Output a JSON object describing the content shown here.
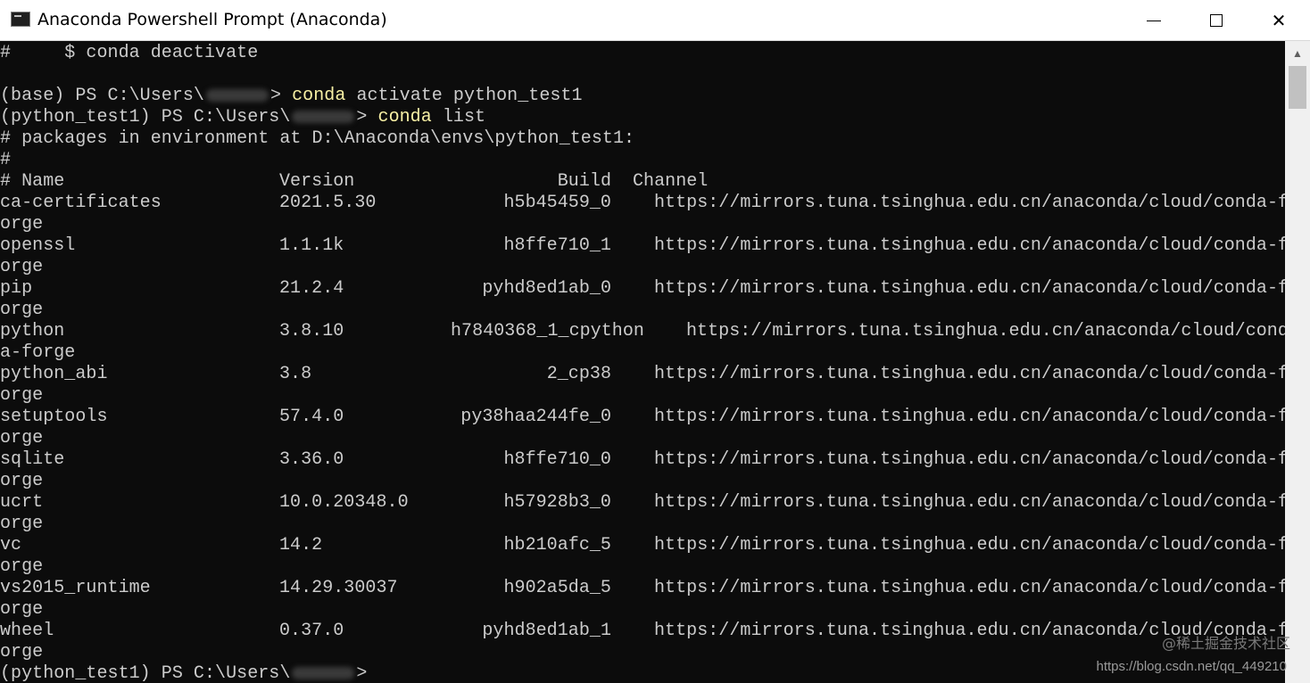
{
  "window": {
    "title": "Anaconda Powershell Prompt (Anaconda)",
    "controls": {
      "minimize": "—",
      "maximize": "☐",
      "close": "✕"
    }
  },
  "console": {
    "line_deactivate": "#     $ conda deactivate",
    "prompt_base": "(base) PS C:\\Users\\",
    "prompt_env": "(python_test1) PS C:\\Users\\",
    "prompt_end": ">",
    "cmd_activate_1": "conda",
    "cmd_activate_2": " activate python_test1",
    "cmd_list_1": "conda",
    "cmd_list_2": " list",
    "env_header": "# packages in environment at D:\\Anaconda\\envs\\python_test1:",
    "hash_line": "#",
    "columns": {
      "name": "# Name",
      "version": "Version",
      "build": "Build",
      "channel": "Channel"
    },
    "packages": [
      {
        "name": "ca-certificates",
        "version": "2021.5.30",
        "build": "h5b45459_0",
        "channel": "https://mirrors.tuna.tsinghua.edu.cn/anaconda/cloud/conda-f",
        "wrap": "orge"
      },
      {
        "name": "openssl",
        "version": "1.1.1k",
        "build": "h8ffe710_1",
        "channel": "https://mirrors.tuna.tsinghua.edu.cn/anaconda/cloud/conda-f",
        "wrap": "orge"
      },
      {
        "name": "pip",
        "version": "21.2.4",
        "build": "pyhd8ed1ab_0",
        "channel": "https://mirrors.tuna.tsinghua.edu.cn/anaconda/cloud/conda-f",
        "wrap": "orge"
      },
      {
        "name": "python",
        "version": "3.8.10",
        "build": "h7840368_1_cpython",
        "channel": "https://mirrors.tuna.tsinghua.edu.cn/anaconda/cloud/cond",
        "wrap": "a-forge"
      },
      {
        "name": "python_abi",
        "version": "3.8",
        "build": "2_cp38",
        "channel": "https://mirrors.tuna.tsinghua.edu.cn/anaconda/cloud/conda-f",
        "wrap": "orge"
      },
      {
        "name": "setuptools",
        "version": "57.4.0",
        "build": "py38haa244fe_0",
        "channel": "https://mirrors.tuna.tsinghua.edu.cn/anaconda/cloud/conda-f",
        "wrap": "orge"
      },
      {
        "name": "sqlite",
        "version": "3.36.0",
        "build": "h8ffe710_0",
        "channel": "https://mirrors.tuna.tsinghua.edu.cn/anaconda/cloud/conda-f",
        "wrap": "orge"
      },
      {
        "name": "ucrt",
        "version": "10.0.20348.0",
        "build": "h57928b3_0",
        "channel": "https://mirrors.tuna.tsinghua.edu.cn/anaconda/cloud/conda-f",
        "wrap": "orge"
      },
      {
        "name": "vc",
        "version": "14.2",
        "build": "hb210afc_5",
        "channel": "https://mirrors.tuna.tsinghua.edu.cn/anaconda/cloud/conda-f",
        "wrap": "orge"
      },
      {
        "name": "vs2015_runtime",
        "version": "14.29.30037",
        "build": "h902a5da_5",
        "channel": "https://mirrors.tuna.tsinghua.edu.cn/anaconda/cloud/conda-f",
        "wrap": "orge"
      },
      {
        "name": "wheel",
        "version": "0.37.0",
        "build": "pyhd8ed1ab_1",
        "channel": "https://mirrors.tuna.tsinghua.edu.cn/anaconda/cloud/conda-f",
        "wrap": "orge"
      }
    ]
  },
  "watermark": {
    "brand": "@稀土掘金技术社区",
    "url": "https://blog.csdn.net/qq_449210"
  },
  "colors": {
    "background": "#0c0c0c",
    "text": "#cccccc",
    "command": "#f9f1a5"
  },
  "icons": {
    "app": "terminal-icon",
    "scroll_up": "chevron-up-icon"
  }
}
